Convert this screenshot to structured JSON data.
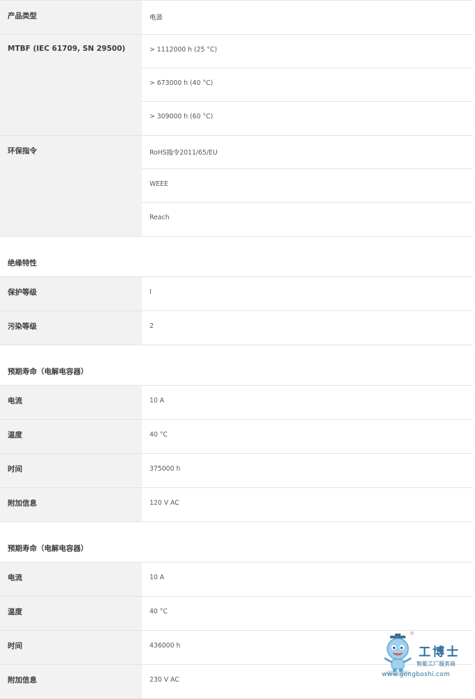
{
  "rows_top": [
    {
      "label": "产品类型",
      "values": [
        "电源"
      ]
    },
    {
      "label": "MTBF (IEC 61709, SN 29500)",
      "values": [
        "> 1112000 h (25 °C)",
        "> 673000 h (40 °C)",
        "> 309000 h (60 °C)"
      ]
    },
    {
      "label": "环保指令",
      "values": [
        "RoHS指令2011/65/EU",
        "WEEE",
        "Reach"
      ]
    }
  ],
  "insulation": {
    "heading": "绝缘特性",
    "rows": [
      {
        "label": "保护等级",
        "value": "I"
      },
      {
        "label": "污染等级",
        "value": "2"
      }
    ]
  },
  "life1": {
    "heading": "预期寿命（电解电容器）",
    "rows": [
      {
        "label": "电流",
        "value": "10 A"
      },
      {
        "label": "温度",
        "value": "40 °C"
      },
      {
        "label": "时间",
        "value": "375000 h"
      },
      {
        "label": "附加信息",
        "value": "120 V AC"
      }
    ]
  },
  "life2": {
    "heading": "预期寿命（电解电容器）",
    "rows": [
      {
        "label": "电流",
        "value": "10 A"
      },
      {
        "label": "温度",
        "value": "40 °C"
      },
      {
        "label": "时间",
        "value": "436000 h"
      },
      {
        "label": "附加信息",
        "value": "230 V AC"
      }
    ]
  },
  "watermark": {
    "reg": "®",
    "brand": "工博士",
    "slogan": "智能工厂服务商",
    "url": "www.gongboshi.com",
    "color": "#2c6f9e"
  }
}
